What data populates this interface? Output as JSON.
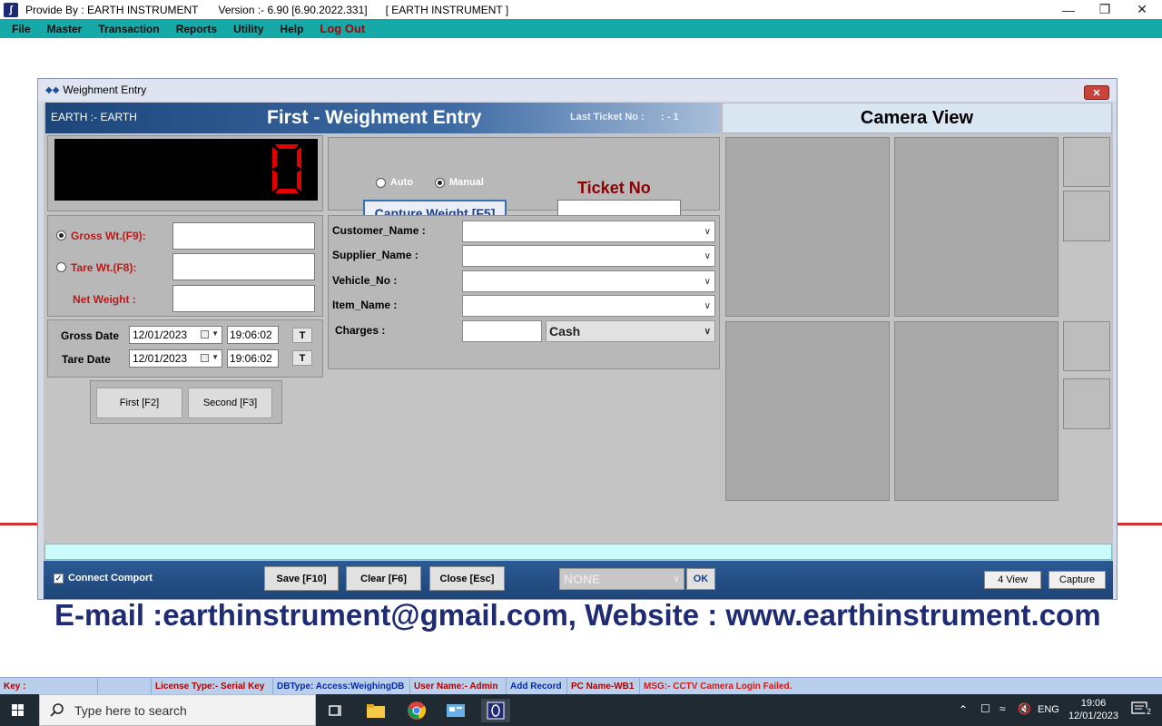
{
  "titlebar": {
    "provider": "Provide By : EARTH INSTRUMENT",
    "version": "Version :- 6.90 [6.90.2022.331]",
    "company": "[ EARTH INSTRUMENT ]"
  },
  "menu": {
    "items": [
      "File",
      "Master",
      "Transaction",
      "Reports",
      "Utility",
      "Help"
    ],
    "logout": "Log Out"
  },
  "dialog": {
    "title": "Weighment Entry",
    "close": "✕",
    "earth_label": "EARTH :- EARTH",
    "form_title": "First - Weighment Entry",
    "last_ticket_label": "Last Ticket No :",
    "last_ticket_value": ": - 1",
    "camera_title": "Camera View"
  },
  "weight_display": {
    "value": "0"
  },
  "weights": {
    "gross_label": "Gross Wt.(F9):",
    "tare_label": "Tare Wt.(F8):",
    "net_label": "Net Weight :",
    "selected": "gross"
  },
  "dates": {
    "gross_label": "Gross Date",
    "tare_label": "Tare Date",
    "gross_date": "12/01/2023",
    "tare_date": "12/01/2023",
    "gross_time": "19:06:02",
    "tare_time": "19:06:02",
    "t_button": "T"
  },
  "weighment_buttons": {
    "first": "First [F2]",
    "second": "Second [F3]"
  },
  "capture": {
    "auto_label": "Auto",
    "manual_label": "Manual",
    "mode": "manual",
    "capture_button": "Capture Weight [F5]",
    "ticket_label": "Ticket No"
  },
  "fields": {
    "customer": "Customer_Name :",
    "supplier": "Supplier_Name :",
    "vehicle": "Vehicle_No :",
    "item": "Item_Name :",
    "charges": "Charges :",
    "payment_mode": "Cash"
  },
  "bottom": {
    "connect_comport": "Connect Comport",
    "save": "Save [F10]",
    "clear": "Clear [F6]",
    "close": "Close [Esc]",
    "camera_select": "NONE",
    "ok": "OK",
    "four_view": "4 View",
    "capture": "Capture"
  },
  "banner": "E-mail :earthinstrument@gmail.com, Website : www.earthinstrument.com",
  "statusbar": {
    "key": "Key :",
    "license": "License Type:- Serial Key",
    "dbtype": "DBType: Access:WeighingDB",
    "user": "User Name:- Admin",
    "add_record": "Add Record",
    "pc_name": "PC Name-WB1",
    "msg": "MSG:- CCTV Camera Login Failed."
  },
  "taskbar": {
    "search_placeholder": "Type here to search",
    "lang": "ENG",
    "time": "19:06",
    "date": "12/01/2023",
    "notifications": "2"
  },
  "colors": {
    "menubar": "#17a8a8",
    "header_blue": "#1c467a",
    "label_red": "#b71c1c",
    "ticket_red": "#8b0000",
    "digit_red": "#e30000"
  }
}
